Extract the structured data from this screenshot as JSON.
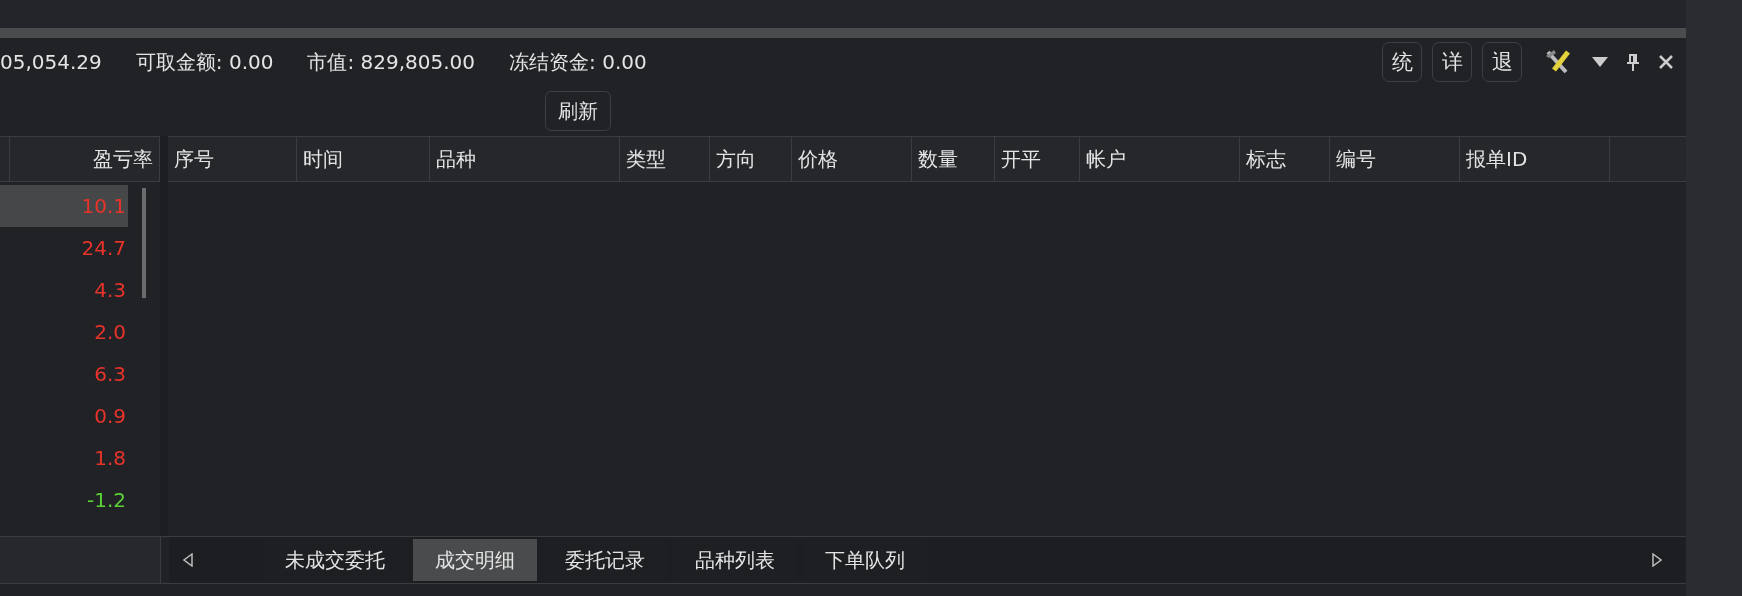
{
  "summary": [
    {
      "value": "05,054.29"
    },
    {
      "label": "可取金额:",
      "value": "0.00"
    },
    {
      "label": "市值:",
      "value": "829,805.00"
    },
    {
      "label": "冻结资金:",
      "value": "0.00"
    }
  ],
  "toolbar_buttons": [
    "统",
    "详",
    "退"
  ],
  "refresh_button": "刷新",
  "positions": {
    "columns": [
      "盈亏率"
    ],
    "rows": [
      {
        "value": "10.1",
        "color": "#e8332b",
        "selected": true
      },
      {
        "value": "24.7",
        "color": "#e8332b",
        "selected": false
      },
      {
        "value": "4.3",
        "color": "#e8332b",
        "selected": false
      },
      {
        "value": "2.0",
        "color": "#e8332b",
        "selected": false
      },
      {
        "value": "6.3",
        "color": "#e8332b",
        "selected": false
      },
      {
        "value": "0.9",
        "color": "#e8332b",
        "selected": false
      },
      {
        "value": "1.8",
        "color": "#e8332b",
        "selected": false
      },
      {
        "value": "-1.2",
        "color": "#5ad236",
        "selected": false
      }
    ]
  },
  "orders": {
    "columns": [
      "序号",
      "时间",
      "品种",
      "类型",
      "方向",
      "价格",
      "数量",
      "开平",
      "帐户",
      "标志",
      "编号",
      "报单ID"
    ]
  },
  "tabs": [
    {
      "label": "未成交委托",
      "selected": false
    },
    {
      "label": "成交明细",
      "selected": true
    },
    {
      "label": "委托记录",
      "selected": false
    },
    {
      "label": "品种列表",
      "selected": false
    },
    {
      "label": "下单队列",
      "selected": false
    }
  ]
}
